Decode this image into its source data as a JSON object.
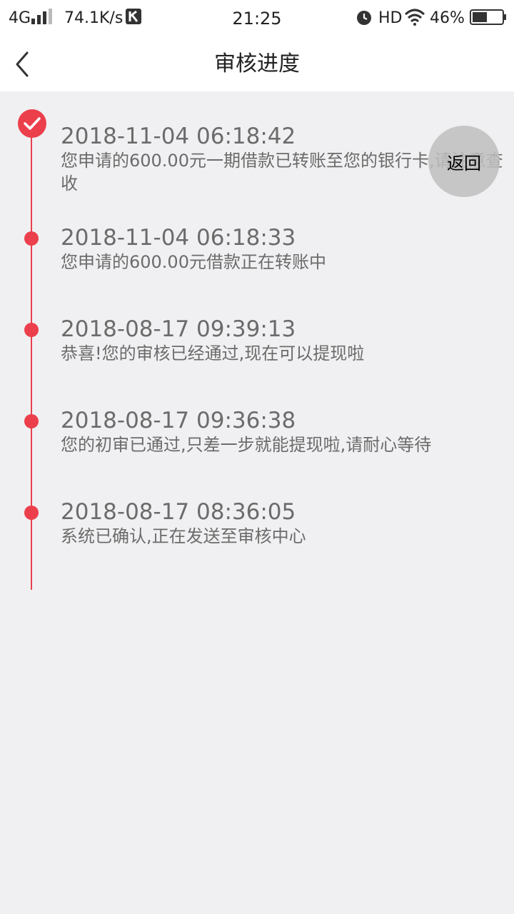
{
  "status_bar": {
    "network": "4G",
    "speed": "74.1K/s",
    "time": "21:25",
    "hd": "HD",
    "battery": "46%"
  },
  "header": {
    "title": "审核进度"
  },
  "timeline": [
    {
      "time": "2018-11-04 06:18:42",
      "text": "您申请的600.00元一期借款已转账至您的银行卡,请注意查收"
    },
    {
      "time": "2018-11-04 06:18:33",
      "text": "您申请的600.00元借款正在转账中"
    },
    {
      "time": "2018-08-17 09:39:13",
      "text": "恭喜!您的审核已经通过,现在可以提现啦"
    },
    {
      "time": "2018-08-17 09:36:38",
      "text": "您的初审已通过,只差一步就能提现啦,请耐心等待"
    },
    {
      "time": "2018-08-17 08:36:05",
      "text": "系统已确认,正在发送至审核中心"
    }
  ],
  "float_button": {
    "label": "返回"
  },
  "colors": {
    "accent": "#ec3f4c",
    "background": "#f0f0f2",
    "text": "#6b6b6b"
  }
}
